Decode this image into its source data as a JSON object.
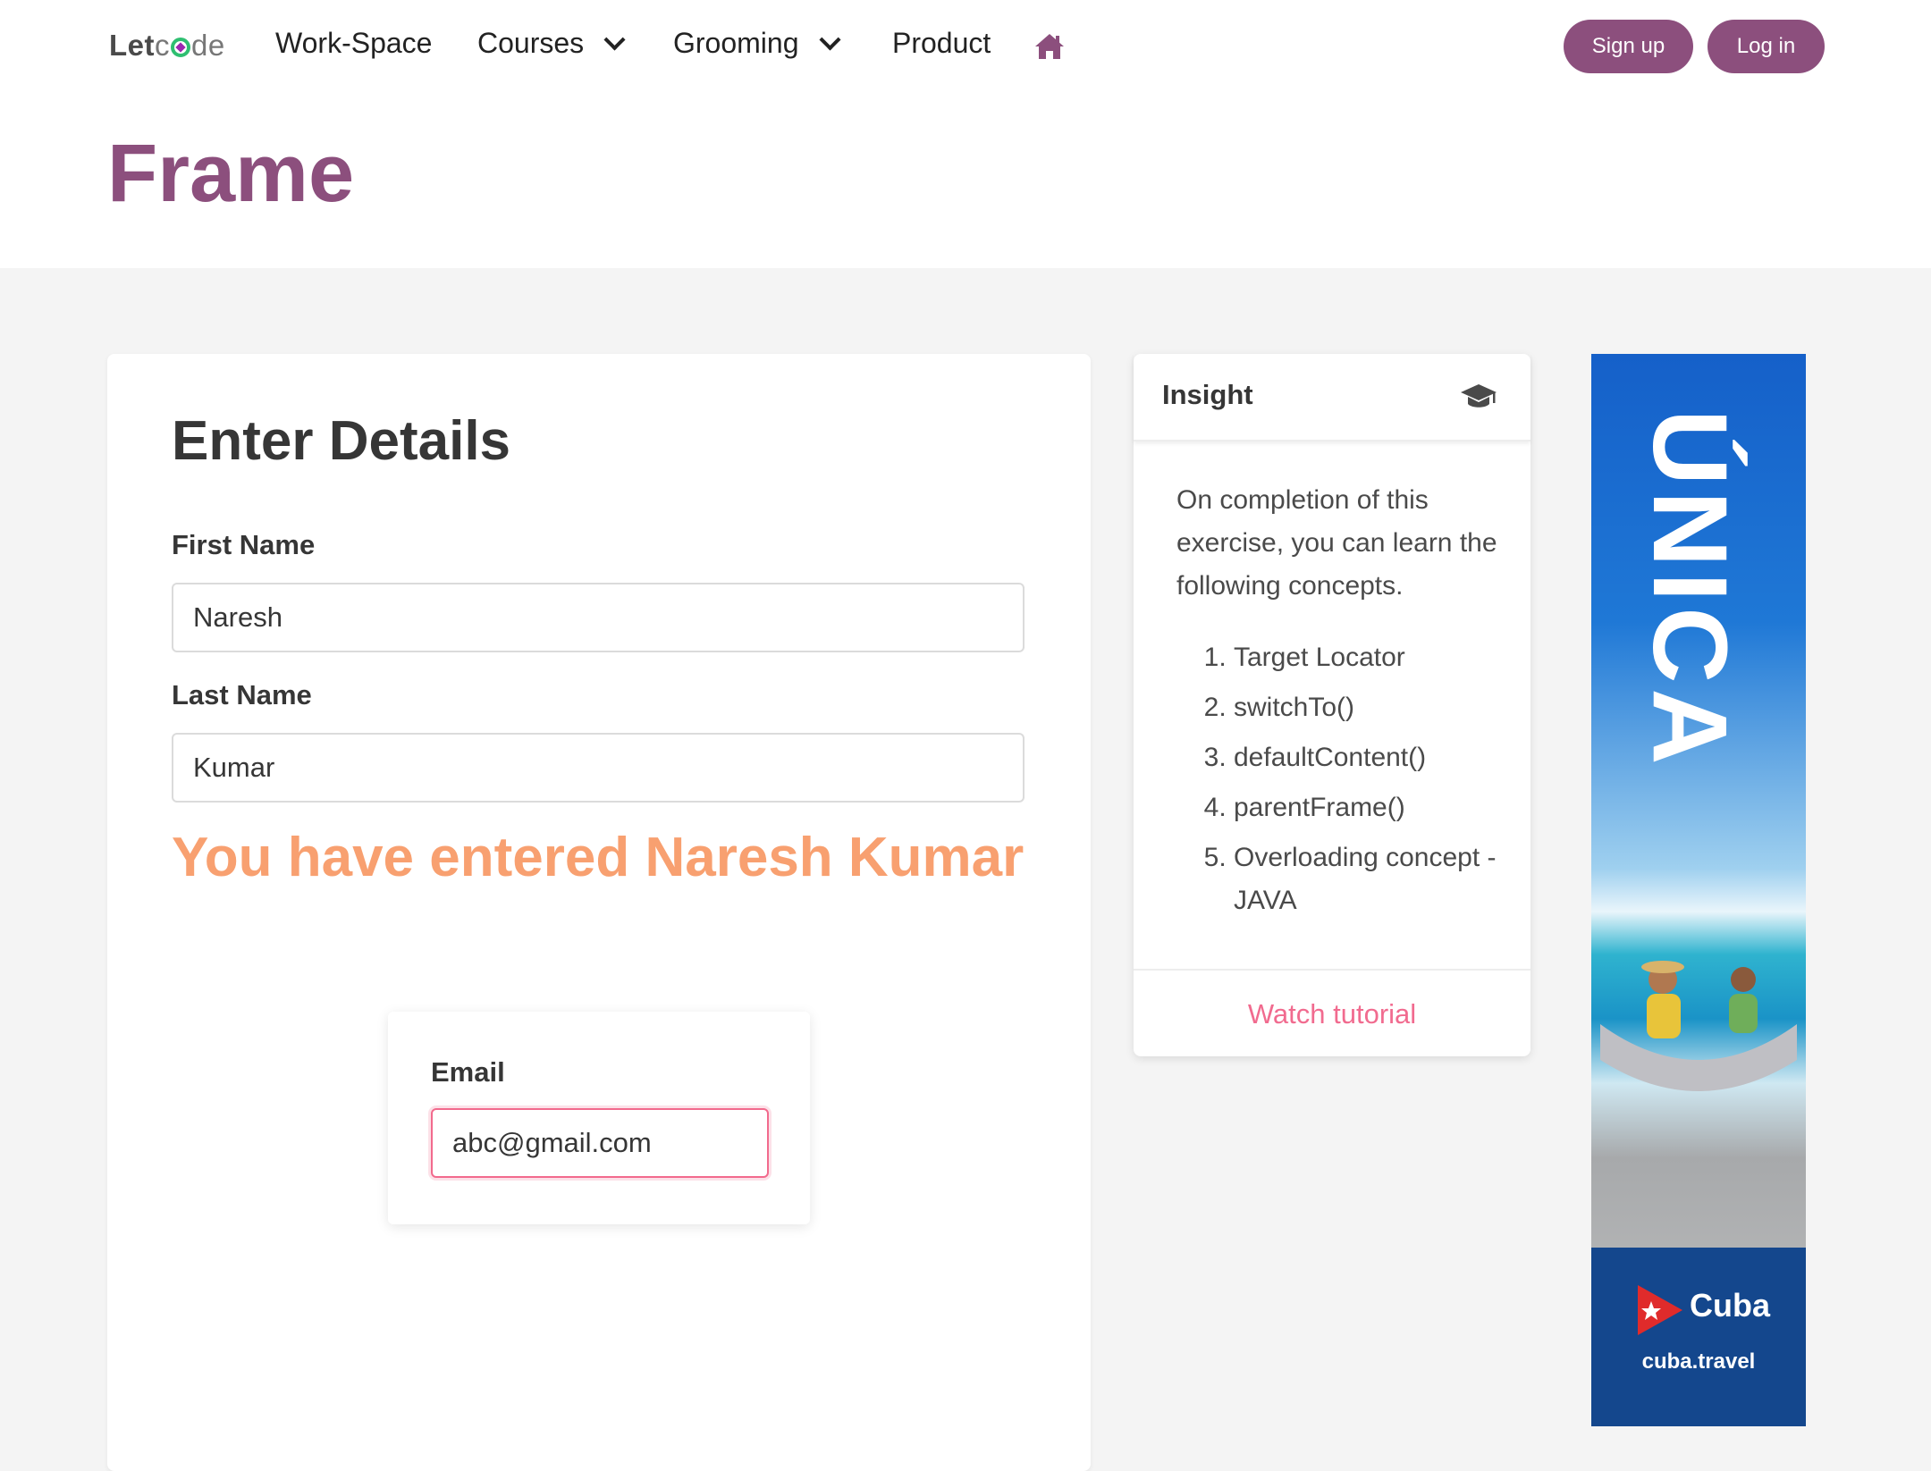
{
  "nav": {
    "logo_bold": "Let",
    "logo_light": "de",
    "items": [
      "Work-Space",
      "Courses",
      "Grooming",
      "Product"
    ],
    "signup": "Sign up",
    "login": "Log in"
  },
  "page_title": "Frame",
  "form": {
    "heading": "Enter Details",
    "first_name_label": "First Name",
    "first_name_value": "Naresh",
    "last_name_label": "Last Name",
    "last_name_value": "Kumar",
    "result": "You have entered Naresh Kumar",
    "email_label": "Email",
    "email_value": "abc@gmail.com"
  },
  "insight": {
    "title": "Insight",
    "intro": "On completion of this exercise, you can learn the following concepts.",
    "concepts": [
      "Target Locator",
      "switchTo()",
      "defaultContent()",
      "parentFrame()",
      "Overloading concept - JAVA"
    ],
    "footer": "Watch tutorial"
  },
  "ad": {
    "headline": "ÚNICA",
    "brand": "Cuba",
    "url": "cuba.travel"
  },
  "colors": {
    "brand": "#8c4f7d",
    "result": "#f8a070",
    "accent_pink": "#f16b8f"
  }
}
